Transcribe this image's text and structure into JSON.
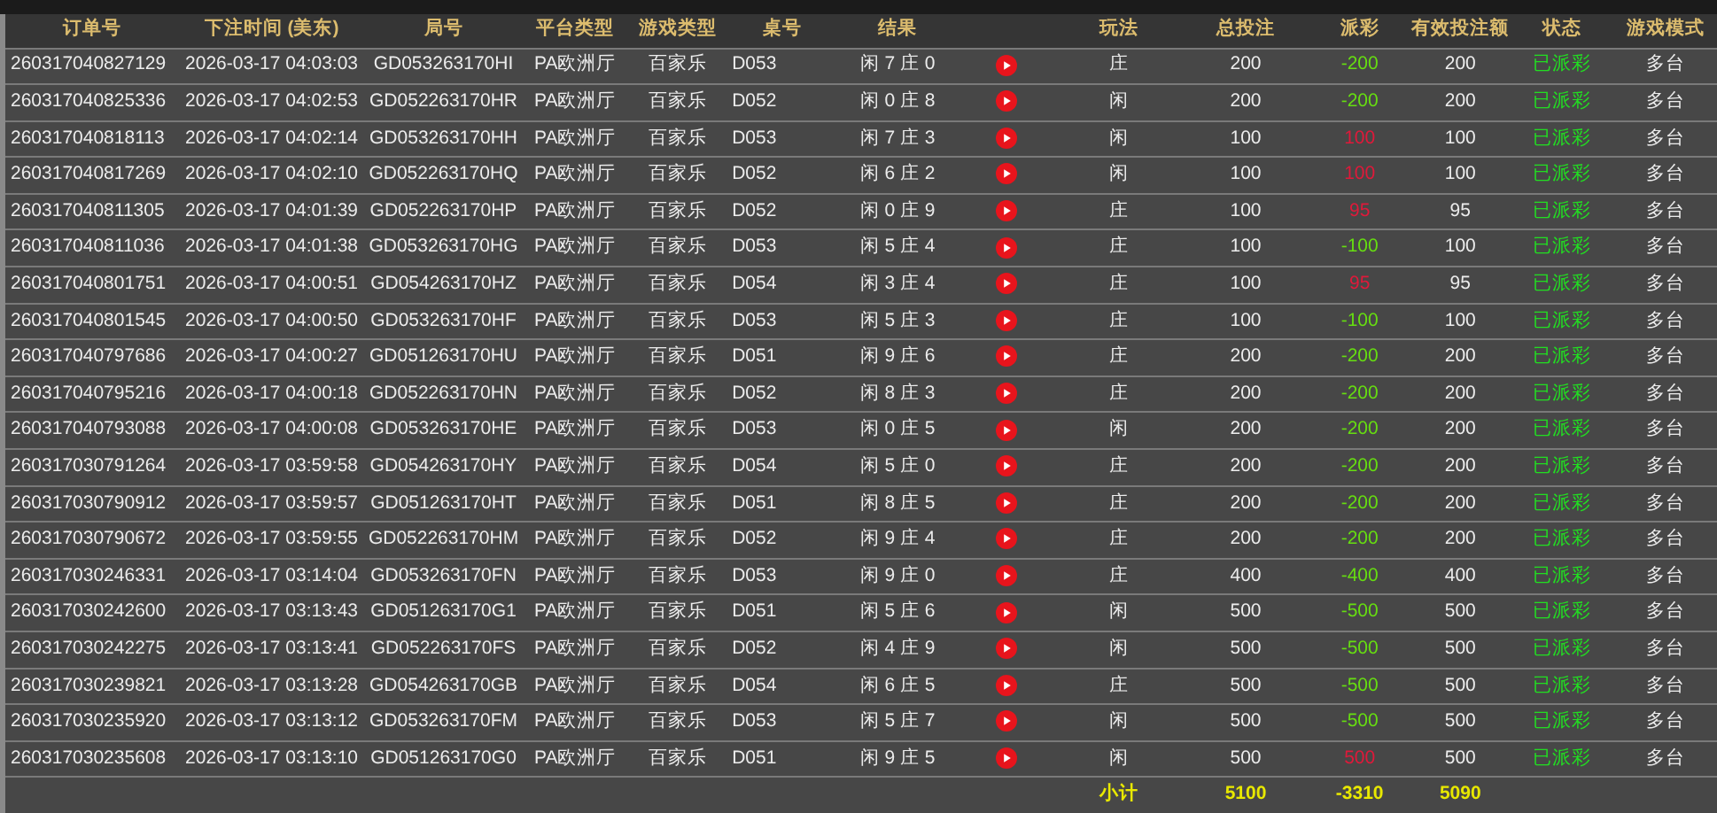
{
  "table": {
    "columns": [
      "订单号",
      "下注时间 (美东)",
      "局号",
      "平台类型",
      "游戏类型",
      "桌号",
      "结果",
      "玩法",
      "总投注",
      "派彩",
      "有效投注额",
      "状态",
      "游戏模式"
    ],
    "rows": [
      {
        "order": "260317040827129",
        "time": "2026-03-17 04:03:03",
        "round": "GD053263170HI",
        "platform": "PA欧洲厅",
        "game": "百家乐",
        "table": "D053",
        "result": "闲 7 庄 0",
        "play": "庄",
        "total_bet": "200",
        "payout": "-200",
        "color": "#66dd11",
        "valid_bet": "200",
        "status": "已派彩",
        "mode": "多台"
      },
      {
        "order": "260317040825336",
        "time": "2026-03-17 04:02:53",
        "round": "GD052263170HR",
        "platform": "PA欧洲厅",
        "game": "百家乐",
        "table": "D052",
        "result": "闲 0 庄 8",
        "play": "闲",
        "total_bet": "200",
        "payout": "-200",
        "color": "#66dd11",
        "valid_bet": "200",
        "status": "已派彩",
        "mode": "多台"
      },
      {
        "order": "260317040818113",
        "time": "2026-03-17 04:02:14",
        "round": "GD053263170HH",
        "platform": "PA欧洲厅",
        "game": "百家乐",
        "table": "D053",
        "result": "闲 7 庄 3",
        "play": "闲",
        "total_bet": "100",
        "payout": "100",
        "color": "#e0193a",
        "valid_bet": "100",
        "status": "已派彩",
        "mode": "多台"
      },
      {
        "order": "260317040817269",
        "time": "2026-03-17 04:02:10",
        "round": "GD052263170HQ",
        "platform": "PA欧洲厅",
        "game": "百家乐",
        "table": "D052",
        "result": "闲 6 庄 2",
        "play": "闲",
        "total_bet": "100",
        "payout": "100",
        "color": "#e0193a",
        "valid_bet": "100",
        "status": "已派彩",
        "mode": "多台"
      },
      {
        "order": "260317040811305",
        "time": "2026-03-17 04:01:39",
        "round": "GD052263170HP",
        "platform": "PA欧洲厅",
        "game": "百家乐",
        "table": "D052",
        "result": "闲 0 庄 9",
        "play": "庄",
        "total_bet": "100",
        "payout": "95",
        "color": "#e0193a",
        "valid_bet": "95",
        "status": "已派彩",
        "mode": "多台"
      },
      {
        "order": "260317040811036",
        "time": "2026-03-17 04:01:38",
        "round": "GD053263170HG",
        "platform": "PA欧洲厅",
        "game": "百家乐",
        "table": "D053",
        "result": "闲 5 庄 4",
        "play": "庄",
        "total_bet": "100",
        "payout": "-100",
        "color": "#66dd11",
        "valid_bet": "100",
        "status": "已派彩",
        "mode": "多台"
      },
      {
        "order": "260317040801751",
        "time": "2026-03-17 04:00:51",
        "round": "GD054263170HZ",
        "platform": "PA欧洲厅",
        "game": "百家乐",
        "table": "D054",
        "result": "闲 3 庄 4",
        "play": "庄",
        "total_bet": "100",
        "payout": "95",
        "color": "#e0193a",
        "valid_bet": "95",
        "status": "已派彩",
        "mode": "多台"
      },
      {
        "order": "260317040801545",
        "time": "2026-03-17 04:00:50",
        "round": "GD053263170HF",
        "platform": "PA欧洲厅",
        "game": "百家乐",
        "table": "D053",
        "result": "闲 5 庄 3",
        "play": "庄",
        "total_bet": "100",
        "payout": "-100",
        "color": "#66dd11",
        "valid_bet": "100",
        "status": "已派彩",
        "mode": "多台"
      },
      {
        "order": "260317040797686",
        "time": "2026-03-17 04:00:27",
        "round": "GD051263170HU",
        "platform": "PA欧洲厅",
        "game": "百家乐",
        "table": "D051",
        "result": "闲 9 庄 6",
        "play": "庄",
        "total_bet": "200",
        "payout": "-200",
        "color": "#66dd11",
        "valid_bet": "200",
        "status": "已派彩",
        "mode": "多台"
      },
      {
        "order": "260317040795216",
        "time": "2026-03-17 04:00:18",
        "round": "GD052263170HN",
        "platform": "PA欧洲厅",
        "game": "百家乐",
        "table": "D052",
        "result": "闲 8 庄 3",
        "play": "庄",
        "total_bet": "200",
        "payout": "-200",
        "color": "#66dd11",
        "valid_bet": "200",
        "status": "已派彩",
        "mode": "多台"
      },
      {
        "order": "260317040793088",
        "time": "2026-03-17 04:00:08",
        "round": "GD053263170HE",
        "platform": "PA欧洲厅",
        "game": "百家乐",
        "table": "D053",
        "result": "闲 0 庄 5",
        "play": "闲",
        "total_bet": "200",
        "payout": "-200",
        "color": "#66dd11",
        "valid_bet": "200",
        "status": "已派彩",
        "mode": "多台"
      },
      {
        "order": "260317030791264",
        "time": "2026-03-17 03:59:58",
        "round": "GD054263170HY",
        "platform": "PA欧洲厅",
        "game": "百家乐",
        "table": "D054",
        "result": "闲 5 庄 0",
        "play": "庄",
        "total_bet": "200",
        "payout": "-200",
        "color": "#66dd11",
        "valid_bet": "200",
        "status": "已派彩",
        "mode": "多台"
      },
      {
        "order": "260317030790912",
        "time": "2026-03-17 03:59:57",
        "round": "GD051263170HT",
        "platform": "PA欧洲厅",
        "game": "百家乐",
        "table": "D051",
        "result": "闲 8 庄 5",
        "play": "庄",
        "total_bet": "200",
        "payout": "-200",
        "color": "#66dd11",
        "valid_bet": "200",
        "status": "已派彩",
        "mode": "多台"
      },
      {
        "order": "260317030790672",
        "time": "2026-03-17 03:59:55",
        "round": "GD052263170HM",
        "platform": "PA欧洲厅",
        "game": "百家乐",
        "table": "D052",
        "result": "闲 9 庄 4",
        "play": "庄",
        "total_bet": "200",
        "payout": "-200",
        "color": "#66dd11",
        "valid_bet": "200",
        "status": "已派彩",
        "mode": "多台"
      },
      {
        "order": "260317030246331",
        "time": "2026-03-17 03:14:04",
        "round": "GD053263170FN",
        "platform": "PA欧洲厅",
        "game": "百家乐",
        "table": "D053",
        "result": "闲 9 庄 0",
        "play": "庄",
        "total_bet": "400",
        "payout": "-400",
        "color": "#66dd11",
        "valid_bet": "400",
        "status": "已派彩",
        "mode": "多台"
      },
      {
        "order": "260317030242600",
        "time": "2026-03-17 03:13:43",
        "round": "GD051263170G1",
        "platform": "PA欧洲厅",
        "game": "百家乐",
        "table": "D051",
        "result": "闲 5 庄 6",
        "play": "闲",
        "total_bet": "500",
        "payout": "-500",
        "color": "#66dd11",
        "valid_bet": "500",
        "status": "已派彩",
        "mode": "多台"
      },
      {
        "order": "260317030242275",
        "time": "2026-03-17 03:13:41",
        "round": "GD052263170FS",
        "platform": "PA欧洲厅",
        "game": "百家乐",
        "table": "D052",
        "result": "闲 4 庄 9",
        "play": "闲",
        "total_bet": "500",
        "payout": "-500",
        "color": "#66dd11",
        "valid_bet": "500",
        "status": "已派彩",
        "mode": "多台"
      },
      {
        "order": "260317030239821",
        "time": "2026-03-17 03:13:28",
        "round": "GD054263170GB",
        "platform": "PA欧洲厅",
        "game": "百家乐",
        "table": "D054",
        "result": "闲 6 庄 5",
        "play": "庄",
        "total_bet": "500",
        "payout": "-500",
        "color": "#66dd11",
        "valid_bet": "500",
        "status": "已派彩",
        "mode": "多台"
      },
      {
        "order": "260317030235920",
        "time": "2026-03-17 03:13:12",
        "round": "GD053263170FM",
        "platform": "PA欧洲厅",
        "game": "百家乐",
        "table": "D053",
        "result": "闲 5 庄 7",
        "play": "闲",
        "total_bet": "500",
        "payout": "-500",
        "color": "#66dd11",
        "valid_bet": "500",
        "status": "已派彩",
        "mode": "多台"
      },
      {
        "order": "260317030235608",
        "time": "2026-03-17 03:13:10",
        "round": "GD051263170G0",
        "platform": "PA欧洲厅",
        "game": "百家乐",
        "table": "D051",
        "result": "闲 9 庄 5",
        "play": "闲",
        "total_bet": "500",
        "payout": "500",
        "color": "#e0193a",
        "valid_bet": "500",
        "status": "已派彩",
        "mode": "多台"
      }
    ],
    "subtotal": {
      "label": "小计",
      "total_bet": "5100",
      "payout": "-3310",
      "valid_bet": "5090"
    }
  }
}
